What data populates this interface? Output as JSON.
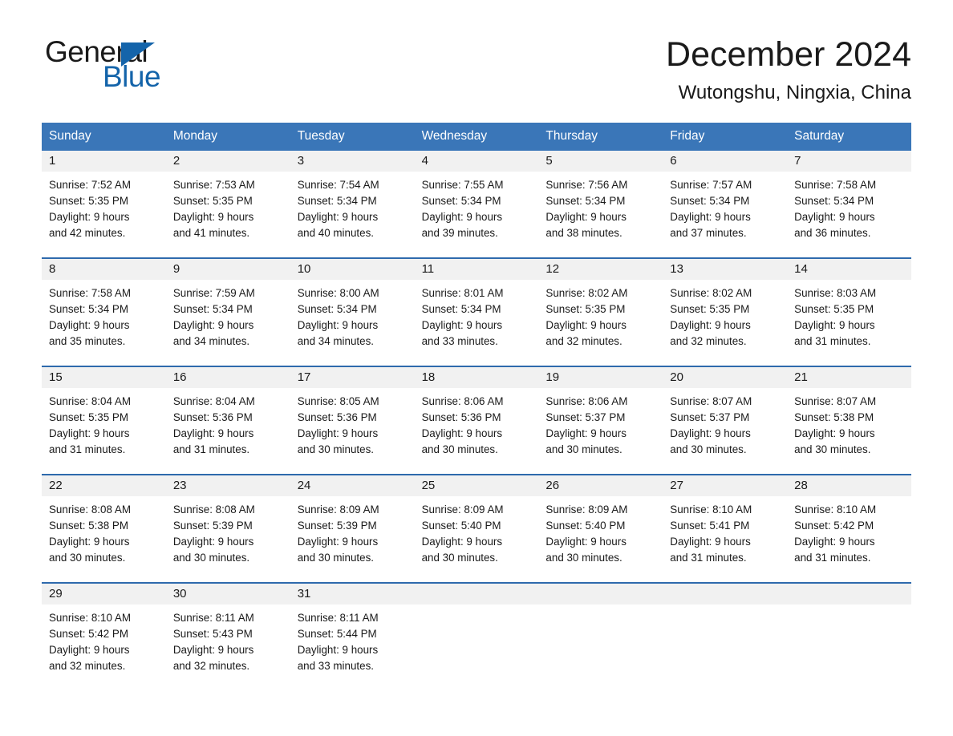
{
  "brand": {
    "name_part1": "General",
    "name_part2": "Blue",
    "triangle_icon": "triangle-icon",
    "accent_color": "#1464aa"
  },
  "header": {
    "month_title": "December 2024",
    "location": "Wutongshu, Ningxia, China"
  },
  "calendar": {
    "header_bg": "#3a76b8",
    "row_border_color": "#2e6aad",
    "daynum_bg": "#f1f1f1",
    "weekdays": [
      "Sunday",
      "Monday",
      "Tuesday",
      "Wednesday",
      "Thursday",
      "Friday",
      "Saturday"
    ],
    "weeks": [
      [
        {
          "day": "1",
          "sunrise": "Sunrise: 7:52 AM",
          "sunset": "Sunset: 5:35 PM",
          "daylight_line1": "Daylight: 9 hours",
          "daylight_line2": "and 42 minutes."
        },
        {
          "day": "2",
          "sunrise": "Sunrise: 7:53 AM",
          "sunset": "Sunset: 5:35 PM",
          "daylight_line1": "Daylight: 9 hours",
          "daylight_line2": "and 41 minutes."
        },
        {
          "day": "3",
          "sunrise": "Sunrise: 7:54 AM",
          "sunset": "Sunset: 5:34 PM",
          "daylight_line1": "Daylight: 9 hours",
          "daylight_line2": "and 40 minutes."
        },
        {
          "day": "4",
          "sunrise": "Sunrise: 7:55 AM",
          "sunset": "Sunset: 5:34 PM",
          "daylight_line1": "Daylight: 9 hours",
          "daylight_line2": "and 39 minutes."
        },
        {
          "day": "5",
          "sunrise": "Sunrise: 7:56 AM",
          "sunset": "Sunset: 5:34 PM",
          "daylight_line1": "Daylight: 9 hours",
          "daylight_line2": "and 38 minutes."
        },
        {
          "day": "6",
          "sunrise": "Sunrise: 7:57 AM",
          "sunset": "Sunset: 5:34 PM",
          "daylight_line1": "Daylight: 9 hours",
          "daylight_line2": "and 37 minutes."
        },
        {
          "day": "7",
          "sunrise": "Sunrise: 7:58 AM",
          "sunset": "Sunset: 5:34 PM",
          "daylight_line1": "Daylight: 9 hours",
          "daylight_line2": "and 36 minutes."
        }
      ],
      [
        {
          "day": "8",
          "sunrise": "Sunrise: 7:58 AM",
          "sunset": "Sunset: 5:34 PM",
          "daylight_line1": "Daylight: 9 hours",
          "daylight_line2": "and 35 minutes."
        },
        {
          "day": "9",
          "sunrise": "Sunrise: 7:59 AM",
          "sunset": "Sunset: 5:34 PM",
          "daylight_line1": "Daylight: 9 hours",
          "daylight_line2": "and 34 minutes."
        },
        {
          "day": "10",
          "sunrise": "Sunrise: 8:00 AM",
          "sunset": "Sunset: 5:34 PM",
          "daylight_line1": "Daylight: 9 hours",
          "daylight_line2": "and 34 minutes."
        },
        {
          "day": "11",
          "sunrise": "Sunrise: 8:01 AM",
          "sunset": "Sunset: 5:34 PM",
          "daylight_line1": "Daylight: 9 hours",
          "daylight_line2": "and 33 minutes."
        },
        {
          "day": "12",
          "sunrise": "Sunrise: 8:02 AM",
          "sunset": "Sunset: 5:35 PM",
          "daylight_line1": "Daylight: 9 hours",
          "daylight_line2": "and 32 minutes."
        },
        {
          "day": "13",
          "sunrise": "Sunrise: 8:02 AM",
          "sunset": "Sunset: 5:35 PM",
          "daylight_line1": "Daylight: 9 hours",
          "daylight_line2": "and 32 minutes."
        },
        {
          "day": "14",
          "sunrise": "Sunrise: 8:03 AM",
          "sunset": "Sunset: 5:35 PM",
          "daylight_line1": "Daylight: 9 hours",
          "daylight_line2": "and 31 minutes."
        }
      ],
      [
        {
          "day": "15",
          "sunrise": "Sunrise: 8:04 AM",
          "sunset": "Sunset: 5:35 PM",
          "daylight_line1": "Daylight: 9 hours",
          "daylight_line2": "and 31 minutes."
        },
        {
          "day": "16",
          "sunrise": "Sunrise: 8:04 AM",
          "sunset": "Sunset: 5:36 PM",
          "daylight_line1": "Daylight: 9 hours",
          "daylight_line2": "and 31 minutes."
        },
        {
          "day": "17",
          "sunrise": "Sunrise: 8:05 AM",
          "sunset": "Sunset: 5:36 PM",
          "daylight_line1": "Daylight: 9 hours",
          "daylight_line2": "and 30 minutes."
        },
        {
          "day": "18",
          "sunrise": "Sunrise: 8:06 AM",
          "sunset": "Sunset: 5:36 PM",
          "daylight_line1": "Daylight: 9 hours",
          "daylight_line2": "and 30 minutes."
        },
        {
          "day": "19",
          "sunrise": "Sunrise: 8:06 AM",
          "sunset": "Sunset: 5:37 PM",
          "daylight_line1": "Daylight: 9 hours",
          "daylight_line2": "and 30 minutes."
        },
        {
          "day": "20",
          "sunrise": "Sunrise: 8:07 AM",
          "sunset": "Sunset: 5:37 PM",
          "daylight_line1": "Daylight: 9 hours",
          "daylight_line2": "and 30 minutes."
        },
        {
          "day": "21",
          "sunrise": "Sunrise: 8:07 AM",
          "sunset": "Sunset: 5:38 PM",
          "daylight_line1": "Daylight: 9 hours",
          "daylight_line2": "and 30 minutes."
        }
      ],
      [
        {
          "day": "22",
          "sunrise": "Sunrise: 8:08 AM",
          "sunset": "Sunset: 5:38 PM",
          "daylight_line1": "Daylight: 9 hours",
          "daylight_line2": "and 30 minutes."
        },
        {
          "day": "23",
          "sunrise": "Sunrise: 8:08 AM",
          "sunset": "Sunset: 5:39 PM",
          "daylight_line1": "Daylight: 9 hours",
          "daylight_line2": "and 30 minutes."
        },
        {
          "day": "24",
          "sunrise": "Sunrise: 8:09 AM",
          "sunset": "Sunset: 5:39 PM",
          "daylight_line1": "Daylight: 9 hours",
          "daylight_line2": "and 30 minutes."
        },
        {
          "day": "25",
          "sunrise": "Sunrise: 8:09 AM",
          "sunset": "Sunset: 5:40 PM",
          "daylight_line1": "Daylight: 9 hours",
          "daylight_line2": "and 30 minutes."
        },
        {
          "day": "26",
          "sunrise": "Sunrise: 8:09 AM",
          "sunset": "Sunset: 5:40 PM",
          "daylight_line1": "Daylight: 9 hours",
          "daylight_line2": "and 30 minutes."
        },
        {
          "day": "27",
          "sunrise": "Sunrise: 8:10 AM",
          "sunset": "Sunset: 5:41 PM",
          "daylight_line1": "Daylight: 9 hours",
          "daylight_line2": "and 31 minutes."
        },
        {
          "day": "28",
          "sunrise": "Sunrise: 8:10 AM",
          "sunset": "Sunset: 5:42 PM",
          "daylight_line1": "Daylight: 9 hours",
          "daylight_line2": "and 31 minutes."
        }
      ],
      [
        {
          "day": "29",
          "sunrise": "Sunrise: 8:10 AM",
          "sunset": "Sunset: 5:42 PM",
          "daylight_line1": "Daylight: 9 hours",
          "daylight_line2": "and 32 minutes."
        },
        {
          "day": "30",
          "sunrise": "Sunrise: 8:11 AM",
          "sunset": "Sunset: 5:43 PM",
          "daylight_line1": "Daylight: 9 hours",
          "daylight_line2": "and 32 minutes."
        },
        {
          "day": "31",
          "sunrise": "Sunrise: 8:11 AM",
          "sunset": "Sunset: 5:44 PM",
          "daylight_line1": "Daylight: 9 hours",
          "daylight_line2": "and 33 minutes."
        },
        {
          "day": "",
          "sunrise": "",
          "sunset": "",
          "daylight_line1": "",
          "daylight_line2": ""
        },
        {
          "day": "",
          "sunrise": "",
          "sunset": "",
          "daylight_line1": "",
          "daylight_line2": ""
        },
        {
          "day": "",
          "sunrise": "",
          "sunset": "",
          "daylight_line1": "",
          "daylight_line2": ""
        },
        {
          "day": "",
          "sunrise": "",
          "sunset": "",
          "daylight_line1": "",
          "daylight_line2": ""
        }
      ]
    ]
  }
}
